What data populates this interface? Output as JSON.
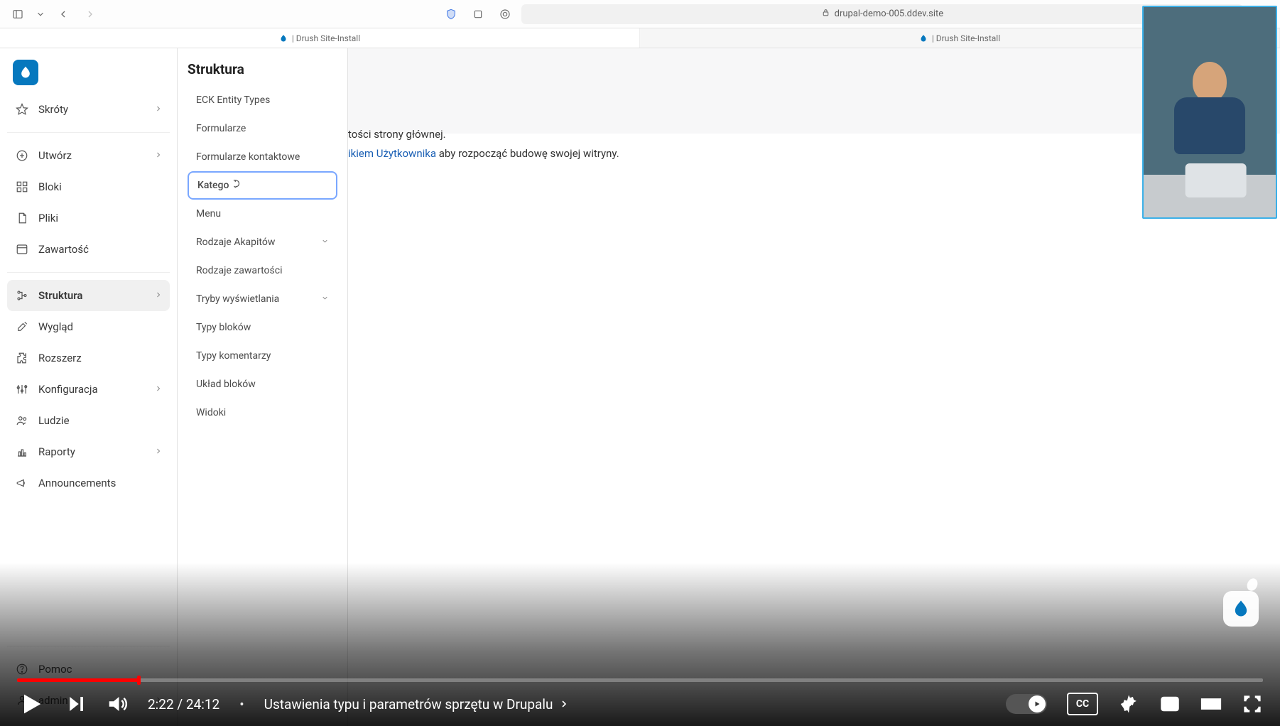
{
  "browser": {
    "url_display": "drupal-demo-005.ddev.site",
    "tabs": [
      {
        "label": "| Drush Site-Install"
      },
      {
        "label": "| Drush Site-Install"
      }
    ]
  },
  "sidebar": {
    "groups": [
      {
        "id": "skroty",
        "label": "Skróty",
        "icon": "star",
        "chev": true
      }
    ],
    "groups2": [
      {
        "id": "utworz",
        "label": "Utwórz",
        "icon": "plus-circle",
        "chev": true
      },
      {
        "id": "bloki",
        "label": "Bloki",
        "icon": "grid",
        "chev": false
      },
      {
        "id": "pliki",
        "label": "Pliki",
        "icon": "file",
        "chev": false
      },
      {
        "id": "zawartosc",
        "label": "Zawartość",
        "icon": "layout",
        "chev": false
      }
    ],
    "groups3": [
      {
        "id": "struktura",
        "label": "Struktura",
        "icon": "hierarchy",
        "chev": true,
        "selected": true
      },
      {
        "id": "wyglad",
        "label": "Wygląd",
        "icon": "brush",
        "chev": false
      },
      {
        "id": "rozszerz",
        "label": "Rozszerz",
        "icon": "puzzle",
        "chev": false
      },
      {
        "id": "konfiguracja",
        "label": "Konfiguracja",
        "icon": "sliders",
        "chev": true
      },
      {
        "id": "ludzie",
        "label": "Ludzie",
        "icon": "users",
        "chev": false
      },
      {
        "id": "raporty",
        "label": "Raporty",
        "icon": "chart",
        "chev": true
      },
      {
        "id": "announcements",
        "label": "Announcements",
        "icon": "megaphone",
        "chev": false
      }
    ],
    "footer": [
      {
        "id": "pomoc",
        "label": "Pomoc",
        "icon": "help",
        "chev": false
      },
      {
        "id": "admin",
        "label": "admin",
        "icon": "user",
        "chev": true
      }
    ]
  },
  "subpanel": {
    "title": "Struktura",
    "items": [
      {
        "label": "ECK Entity Types"
      },
      {
        "label": "Formularze"
      },
      {
        "label": "Formularze kontaktowe"
      },
      {
        "label": "Katego",
        "highlight": true,
        "cursor": true
      },
      {
        "label": "Menu"
      },
      {
        "label": "Rodzaje Akapitów",
        "chev": true
      },
      {
        "label": "Rodzaje zawartości"
      },
      {
        "label": "Tryby wyświetlania",
        "chev": true
      },
      {
        "label": "Typy bloków"
      },
      {
        "label": "Typy komentarzy"
      },
      {
        "label": "Układ bloków"
      },
      {
        "label": "Widoki"
      }
    ]
  },
  "main": {
    "frag_line1": "tości strony głównej.",
    "frag_link": "ikiem Użytkownika",
    "frag_line2_after": " aby rozpocząć budowę swojej witryny."
  },
  "player": {
    "time_current": "2:22",
    "time_total": "24:12",
    "chapter_separator": "•",
    "chapter_title": "Ustawienia typu i parametrów sprzętu w Drupalu",
    "cc_label": "CC"
  }
}
